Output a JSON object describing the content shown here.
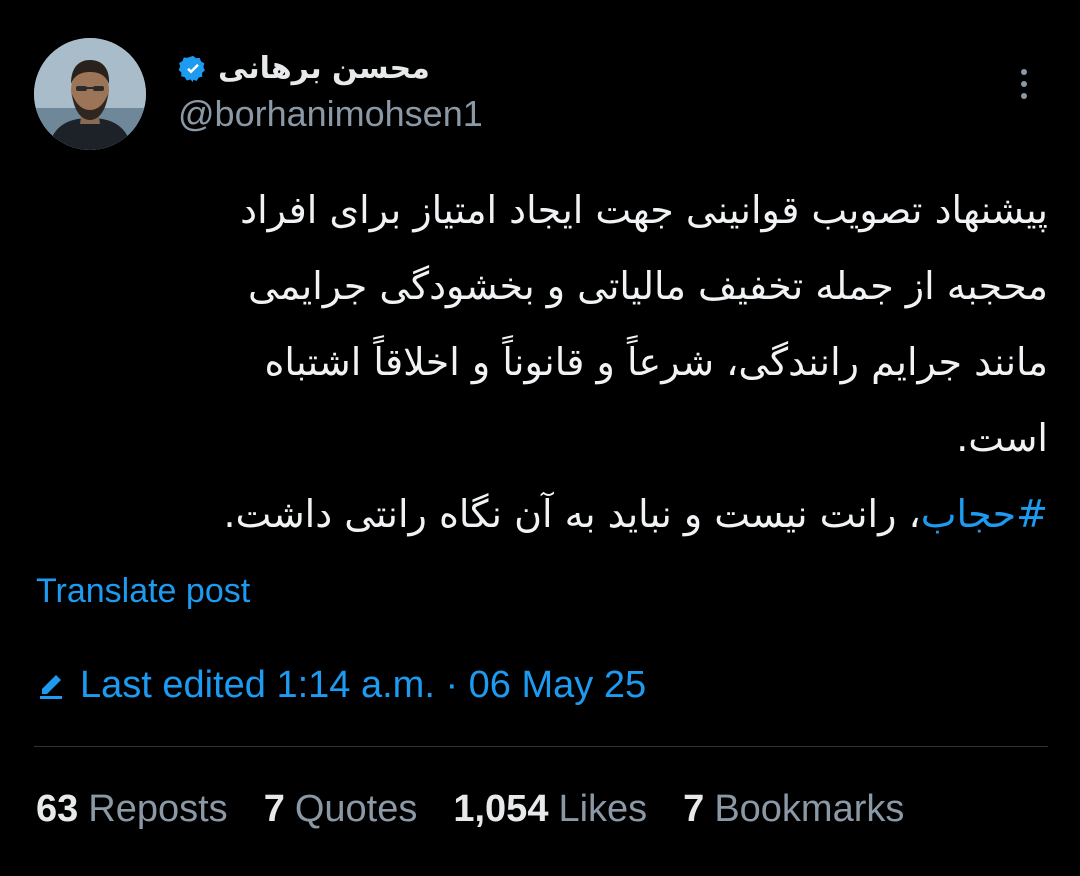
{
  "author": {
    "display_name": "محسن برهانی",
    "handle": "@borhanimohsen1",
    "verified": true,
    "verified_color": "#1d9bf0"
  },
  "post": {
    "lines": [
      "پیشنهاد تصویب قوانینی جهت ایجاد امتیاز برای افراد",
      "محجبه از جمله تخفیف مالیاتی و بخشودگی جرایمی",
      "مانند جرایم رانندگی، شرعاً و قانوناً و اخلاقاً اشتباه",
      "است."
    ],
    "last_line_hashtag": "#حجاب",
    "last_line_rest": "، رانت نیست و نباید به آن نگاه رانتی داشت."
  },
  "translate_label": "Translate post",
  "edited_label": "Last edited 1:14 a.m. · 06 May 25",
  "stats": [
    {
      "count": "63",
      "label": "Reposts"
    },
    {
      "count": "7",
      "label": "Quotes"
    },
    {
      "count": "1,054",
      "label": "Likes"
    },
    {
      "count": "7",
      "label": "Bookmarks"
    }
  ],
  "colors": {
    "background": "#000000",
    "link": "#1d9bf0",
    "secondary_text": "#8b98a5",
    "divider": "#2f3336"
  },
  "icons": {
    "verified": "verified-badge-icon",
    "more": "more-vertical-icon",
    "edited": "pencil-icon"
  }
}
